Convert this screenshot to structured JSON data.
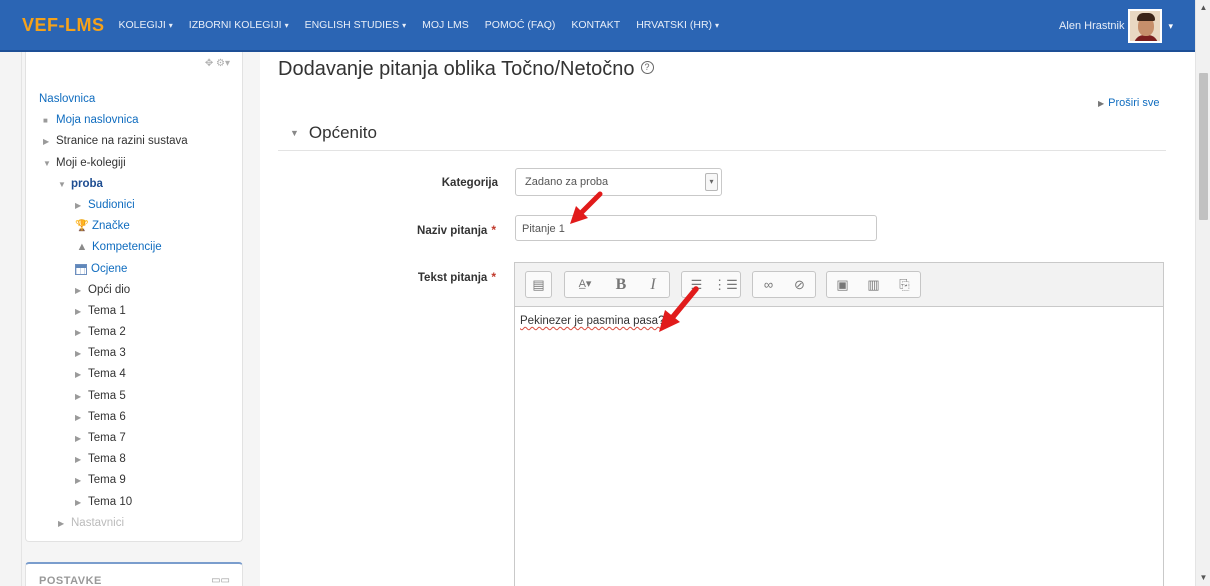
{
  "topbar": {
    "brand": "VEF-LMS",
    "nav": [
      {
        "label": "KOLEGIJI",
        "has_caret": true
      },
      {
        "label": "IZBORNI KOLEGIJI",
        "has_caret": true
      },
      {
        "label": "ENGLISH STUDIES",
        "has_caret": true
      },
      {
        "label": "MOJ LMS",
        "has_caret": false
      },
      {
        "label": "POMOĆ (FAQ)",
        "has_caret": false
      },
      {
        "label": "KONTAKT",
        "has_caret": false
      },
      {
        "label": "HRVATSKI (HR)",
        "has_caret": true
      }
    ],
    "user_name": "Alen Hrastnik",
    "caret_glyph": "▾"
  },
  "sidebar": {
    "tools_icons": "✥ ⚙▾",
    "root": "Naslovnica",
    "items": [
      {
        "label": "Moja naslovnica",
        "marker": "bullet"
      },
      {
        "label": "Stranice na razini sustava",
        "marker": "collapsed"
      },
      {
        "label": "Moji e-kolegiji",
        "marker": "expanded"
      },
      {
        "label": "proba",
        "marker": "expanded"
      },
      {
        "label": "Sudionici",
        "marker": "collapsed"
      },
      {
        "label": "Značke",
        "icon": "trophy-icon"
      },
      {
        "label": "Kompetencije",
        "icon": "competencies-icon"
      },
      {
        "label": "Ocjene",
        "icon": "grades-table-icon"
      },
      {
        "label": "Opći dio",
        "marker": "collapsed"
      },
      {
        "label": "Tema 1",
        "marker": "collapsed"
      },
      {
        "label": "Tema 2",
        "marker": "collapsed"
      },
      {
        "label": "Tema 3",
        "marker": "collapsed"
      },
      {
        "label": "Tema 4",
        "marker": "collapsed"
      },
      {
        "label": "Tema 5",
        "marker": "collapsed"
      },
      {
        "label": "Tema 6",
        "marker": "collapsed"
      },
      {
        "label": "Tema 7",
        "marker": "collapsed"
      },
      {
        "label": "Tema 8",
        "marker": "collapsed"
      },
      {
        "label": "Tema 9",
        "marker": "collapsed"
      },
      {
        "label": "Tema 10",
        "marker": "collapsed"
      },
      {
        "label": "Nastavnici",
        "marker": "collapsed"
      }
    ],
    "postavke_title": "POSTAVKE"
  },
  "main": {
    "title": "Dodavanje pitanja oblika Točno/Netočno",
    "expand_all": "Proširi sve",
    "section_title": "Općenito",
    "category_label": "Kategorija",
    "category_value": "Zadano za proba",
    "name_label": "Naziv pitanja",
    "name_value": "Pitanje 1",
    "text_label": "Tekst pitanja",
    "text_value": "Pekinezer je pasmina pasa?",
    "required_marker": "*"
  },
  "colors": {
    "topbar": "#2b65b4",
    "brand": "#f6a21a",
    "link": "#0f6cbf",
    "required": "#c0392b",
    "arrow": "#e11b1b"
  }
}
